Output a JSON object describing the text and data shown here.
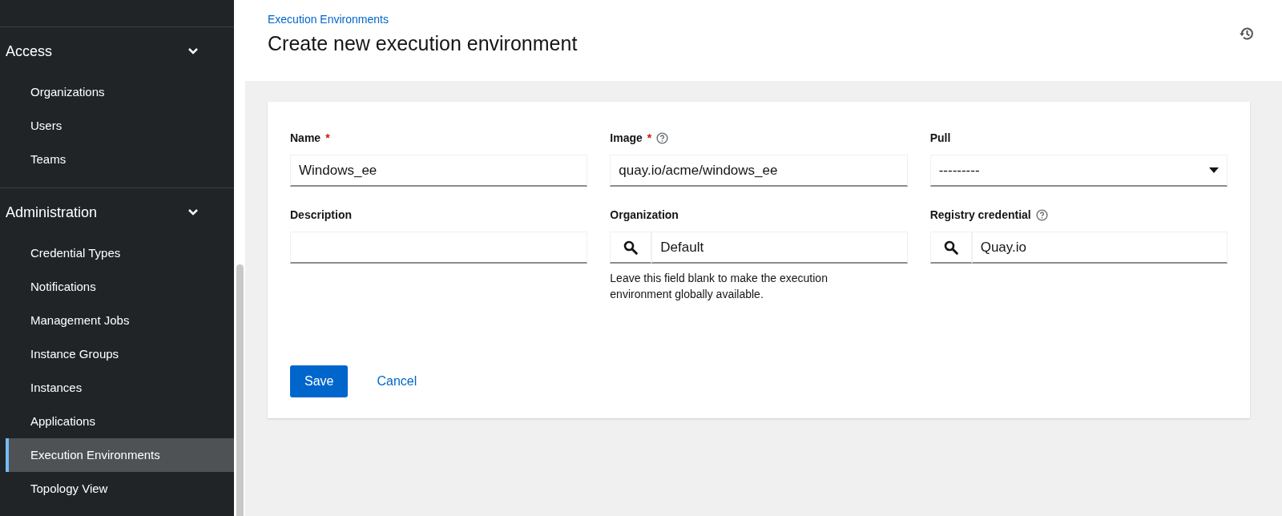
{
  "sidebar": {
    "groups": [
      {
        "title": "Access",
        "expanded": true,
        "items": [
          {
            "label": "Organizations",
            "selected": false
          },
          {
            "label": "Users",
            "selected": false
          },
          {
            "label": "Teams",
            "selected": false
          }
        ]
      },
      {
        "title": "Administration",
        "expanded": true,
        "items": [
          {
            "label": "Credential Types",
            "selected": false
          },
          {
            "label": "Notifications",
            "selected": false
          },
          {
            "label": "Management Jobs",
            "selected": false
          },
          {
            "label": "Instance Groups",
            "selected": false
          },
          {
            "label": "Instances",
            "selected": false
          },
          {
            "label": "Applications",
            "selected": false
          },
          {
            "label": "Execution Environments",
            "selected": true
          },
          {
            "label": "Topology View",
            "selected": false
          }
        ]
      }
    ]
  },
  "header": {
    "breadcrumb": "Execution Environments",
    "title": "Create new execution environment"
  },
  "form": {
    "fields": [
      {
        "kind": "text",
        "label": "Name",
        "required_mark": "*",
        "value": "Windows_ee"
      },
      {
        "kind": "text",
        "label": "Image",
        "required_mark": "*",
        "help": true,
        "value": "quay.io/acme/windows_ee"
      },
      {
        "kind": "select",
        "label": "Pull",
        "value": "---------"
      },
      {
        "kind": "text",
        "label": "Description"
      },
      {
        "kind": "lookup",
        "label": "Organization",
        "value": "Default",
        "helper_text": "Leave this field blank to make the execution environment globally available."
      },
      {
        "kind": "lookup",
        "label": "Registry credential",
        "help": true,
        "value": "Quay.io"
      }
    ],
    "buttons": [
      {
        "kind": "primary",
        "label": "Save"
      },
      {
        "kind": "link",
        "label": "Cancel"
      }
    ]
  }
}
